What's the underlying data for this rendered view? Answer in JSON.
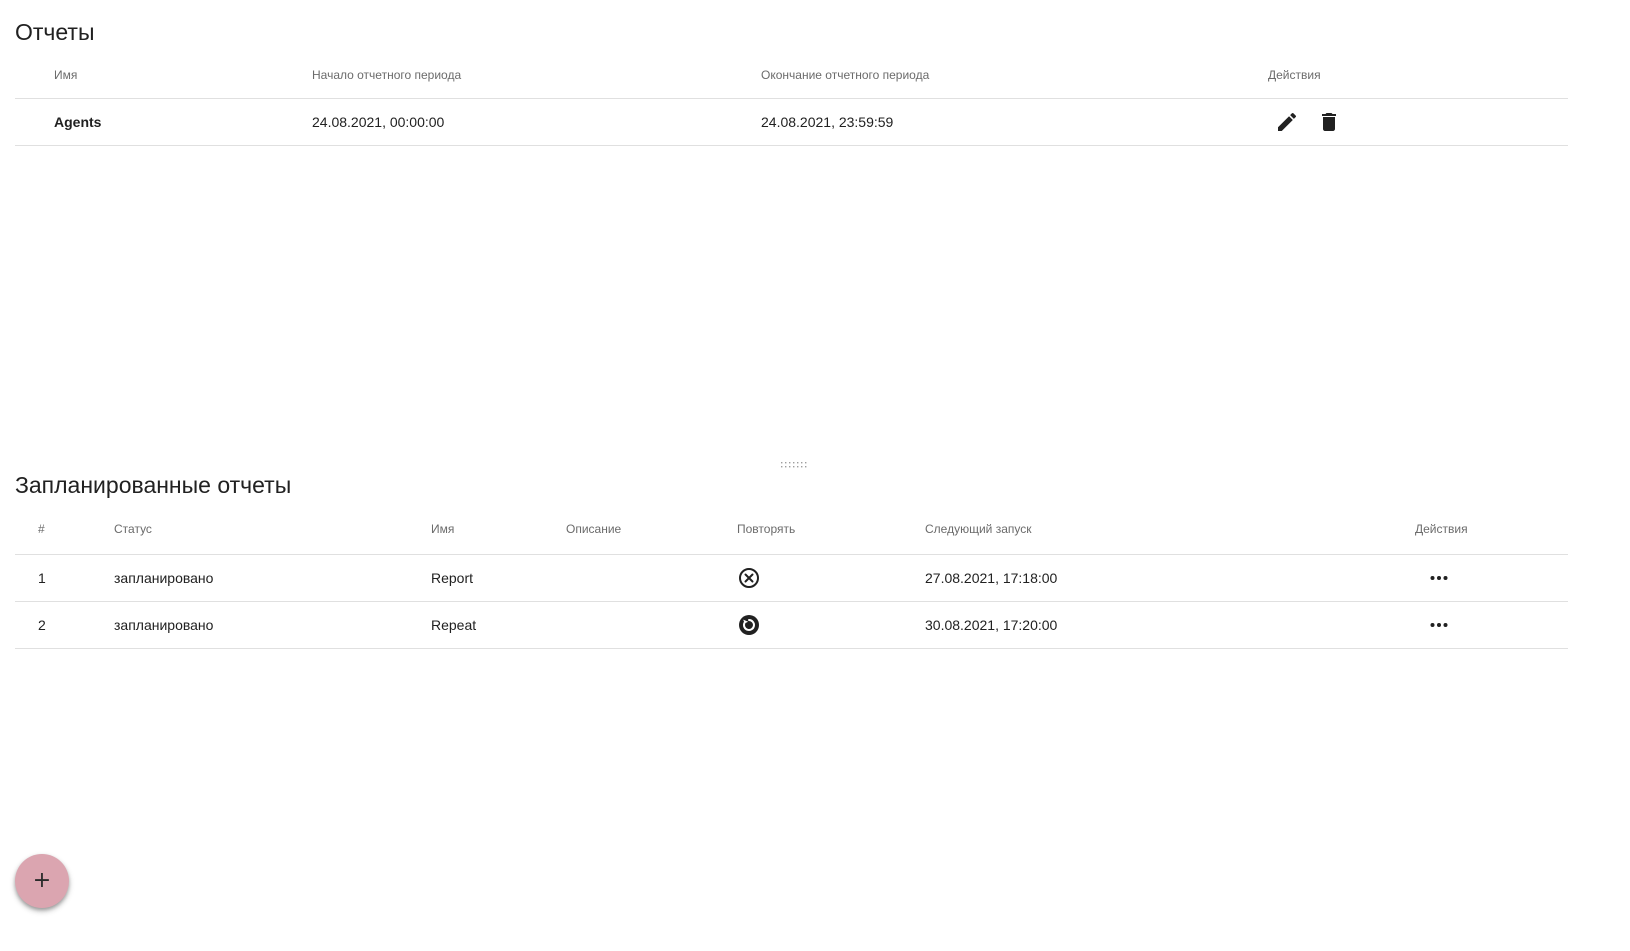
{
  "reports": {
    "title": "Отчеты",
    "columns": {
      "name": "Имя",
      "start": "Начало отчетного периода",
      "end": "Окончание отчетного периода",
      "actions": "Действия"
    },
    "rows": [
      {
        "name": "Agents",
        "start": "24.08.2021, 00:00:00",
        "end": "24.08.2021, 23:59:59",
        "actions": [
          "edit-icon",
          "delete-icon"
        ]
      }
    ]
  },
  "scheduled": {
    "title": "Запланированные отчеты",
    "columns": {
      "num": "#",
      "status": "Статус",
      "name": "Имя",
      "description": "Описание",
      "repeat": "Повторять",
      "next_run": "Следующий запуск",
      "actions": "Действия"
    },
    "rows": [
      {
        "num": "1",
        "status": "запланировано",
        "name": "Report",
        "description": "",
        "repeat_icon": "close-circle-icon",
        "next_run": "27.08.2021, 17:18:00",
        "action_icon": "more-horizontal-icon"
      },
      {
        "num": "2",
        "status": "запланировано",
        "name": "Repeat",
        "description": "",
        "repeat_icon": "repeat-circle-icon",
        "next_run": "30.08.2021, 17:20:00",
        "action_icon": "more-horizontal-icon"
      }
    ]
  },
  "fab": {
    "icon": "plus-icon",
    "label": "+",
    "color": "#dba5b0"
  },
  "splitter": {
    "icon": "drag-handle-icon"
  }
}
